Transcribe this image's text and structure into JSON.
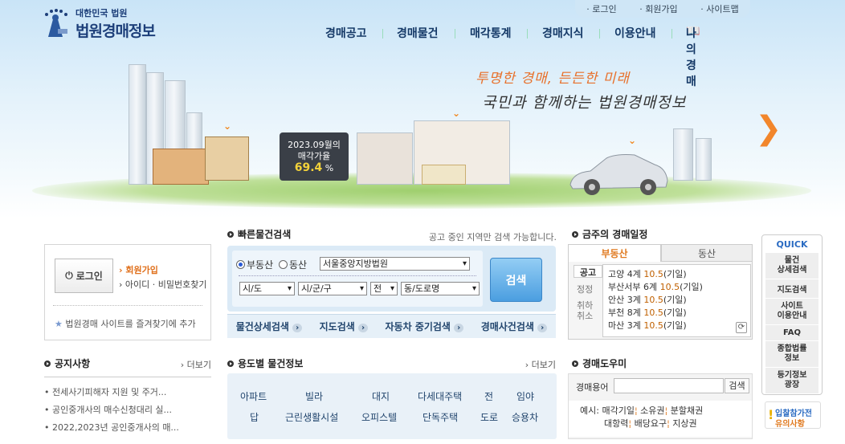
{
  "header": {
    "logo_small": "대한민국 법원",
    "logo_big": "법원경매정보",
    "toplinks": [
      "로그인",
      "회원가입",
      "사이트맵"
    ],
    "nav": [
      "경매공고",
      "경매물건",
      "매각통계",
      "경매지식",
      "이용안내",
      "나의경매"
    ]
  },
  "banner": {
    "slogan1": "투명한 경매, 든든한 미래",
    "slogan2": "국민과 함께하는 법원경매정보",
    "board_line1": "2023.09월의",
    "board_line2": "매각가율",
    "board_value": "69.4",
    "board_unit": "%"
  },
  "login_box": {
    "login_label": "로그인",
    "join_label": "회원가입",
    "find_label": "아이디 · 비밀번호찾기",
    "favorite_label": "법원경매 사이트를 즐겨찾기에 추가"
  },
  "quick_search": {
    "title": "빠른물건검색",
    "note": "공고 중인 지역만 검색 가능합니다.",
    "radio1": "부동산",
    "radio2": "동산",
    "court": "서울중앙지방법원",
    "sido": "시/도",
    "sigungu": "시/군/구",
    "jeon": "전",
    "dong": "동/도로명",
    "search_label": "검색",
    "links": [
      "물건상세검색",
      "지도검색",
      "자동차 중기검색",
      "경매사건검색"
    ]
  },
  "schedule": {
    "title": "금주의 경매일정",
    "tabs": [
      "부동산",
      "동산"
    ],
    "side": [
      "공고",
      "정정",
      "취하\n취소"
    ],
    "rows": [
      {
        "court": "고양",
        "count": "4계",
        "date": "10.5",
        "tag": "(기일)"
      },
      {
        "court": "부산서부",
        "count": "6계",
        "date": "10.5",
        "tag": "(기일)"
      },
      {
        "court": "안산",
        "count": "3계",
        "date": "10.5",
        "tag": "(기일)"
      },
      {
        "court": "부천",
        "count": "8계",
        "date": "10.5",
        "tag": "(기일)"
      },
      {
        "court": "마산",
        "count": "3계",
        "date": "10.5",
        "tag": "(기일)"
      }
    ]
  },
  "quick_menu": {
    "title": "QUICK",
    "items": [
      "물건\n상세검색",
      "지도검색",
      "사이트\n이용안내",
      "FAQ",
      "종합법률\n정보",
      "등기정보\n광장"
    ],
    "notice_top": "입찰참가전",
    "notice_bottom": "유의사항"
  },
  "notice": {
    "title": "공지사항",
    "more": "더보기",
    "items": [
      "전세사기피해자 지원 및 주거...",
      "공인중개사의 매수신청대리 실...",
      "2022,2023년 공인중개사의 매..."
    ]
  },
  "usage": {
    "title": "용도별 물건정보",
    "more": "더보기",
    "row1": [
      "아파트",
      "빌라",
      "대지",
      "다세대주택",
      "전",
      "임야"
    ],
    "row2": [
      "답",
      "근린생활시설",
      "오피스텔",
      "단독주택",
      "도로",
      "승용차"
    ]
  },
  "helper": {
    "title": "경매도우미",
    "term_label": "경매용어",
    "search_label": "검색",
    "example_label": "예시:",
    "row1": [
      "매각기일",
      "소유권",
      "분할채권"
    ],
    "row2": [
      "대항력",
      "배당요구",
      "지상권"
    ]
  },
  "colors": {
    "nav_text": "#143866",
    "accent_orange": "#e8702a",
    "brand_blue": "#1d3f7a",
    "tab_active": "#e07a20",
    "date": "#c06000"
  }
}
